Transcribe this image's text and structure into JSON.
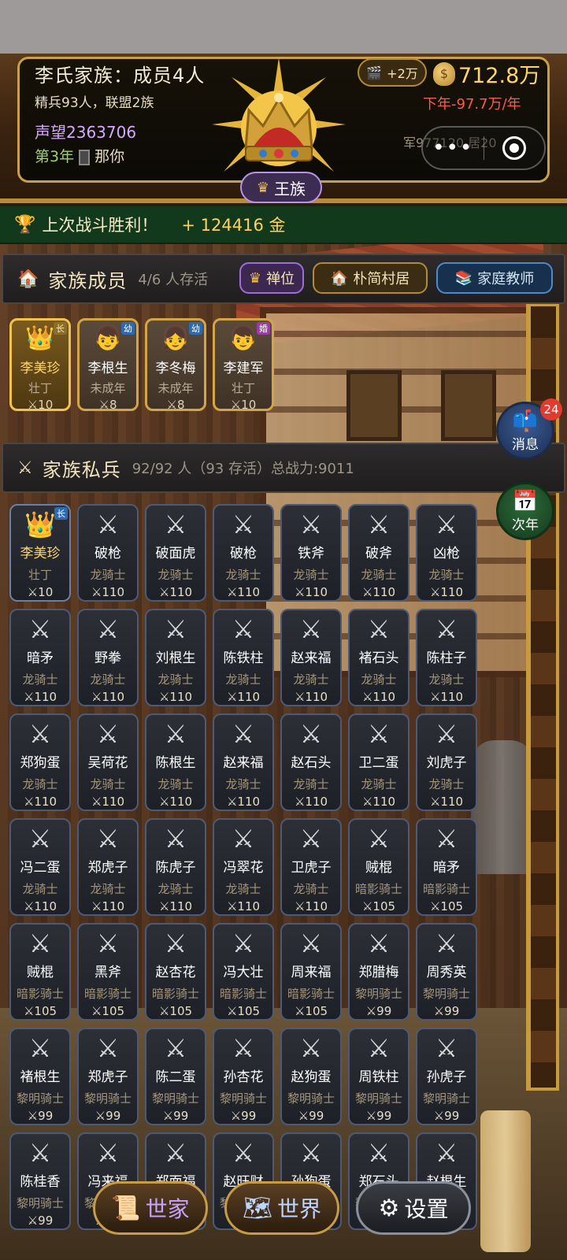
{
  "header": {
    "family_title": "李氏家族：成员4人",
    "family_sub": "精兵93人，联盟2族",
    "prestige": "声望2363706",
    "year": "第3年",
    "you_label": "那你",
    "rank": "王族",
    "video_bonus": "+2万",
    "gold": "712.8万",
    "income": "下年-97.7万/年",
    "army_stats": "军977120 居20",
    "capsule_more": "•••"
  },
  "battle": {
    "message": "上次战斗胜利！",
    "gain": "+ 124416 金"
  },
  "family": {
    "title": "家族成员",
    "meta": "4/6 人存活",
    "btn_abdicate": "禅位",
    "btn_house": "朴简村居",
    "btn_teacher": "家庭教师",
    "members": [
      {
        "name": "李美珍",
        "role": "壮丁",
        "power": "10",
        "tag": "长",
        "icon": "👑"
      },
      {
        "name": "李根生",
        "role": "未成年",
        "power": "8",
        "tag": "幼",
        "icon": "👦"
      },
      {
        "name": "李冬梅",
        "role": "未成年",
        "power": "8",
        "tag": "幼",
        "icon": "👧"
      },
      {
        "name": "李建军",
        "role": "壮丁",
        "power": "10",
        "tag": "婚",
        "icon": "👦"
      }
    ]
  },
  "army": {
    "title": "家族私兵",
    "meta": "92/92 人（93 存活）总战力:9011",
    "leader_tag": "长",
    "soldiers": [
      {
        "name": "李美珍",
        "role": "壮丁",
        "power": "10"
      },
      {
        "name": "破枪",
        "role": "龙骑士",
        "power": "110"
      },
      {
        "name": "破面虎",
        "role": "龙骑士",
        "power": "110"
      },
      {
        "name": "破枪",
        "role": "龙骑士",
        "power": "110"
      },
      {
        "name": "铁斧",
        "role": "龙骑士",
        "power": "110"
      },
      {
        "name": "破斧",
        "role": "龙骑士",
        "power": "110"
      },
      {
        "name": "凶枪",
        "role": "龙骑士",
        "power": "110"
      },
      {
        "name": "暗矛",
        "role": "龙骑士",
        "power": "110"
      },
      {
        "name": "野拳",
        "role": "龙骑士",
        "power": "110"
      },
      {
        "name": "刘根生",
        "role": "龙骑士",
        "power": "110"
      },
      {
        "name": "陈铁柱",
        "role": "龙骑士",
        "power": "110"
      },
      {
        "name": "赵来福",
        "role": "龙骑士",
        "power": "110"
      },
      {
        "name": "褚石头",
        "role": "龙骑士",
        "power": "110"
      },
      {
        "name": "陈柱子",
        "role": "龙骑士",
        "power": "110"
      },
      {
        "name": "郑狗蛋",
        "role": "龙骑士",
        "power": "110"
      },
      {
        "name": "吴荷花",
        "role": "龙骑士",
        "power": "110"
      },
      {
        "name": "陈根生",
        "role": "龙骑士",
        "power": "110"
      },
      {
        "name": "赵来福",
        "role": "龙骑士",
        "power": "110"
      },
      {
        "name": "赵石头",
        "role": "龙骑士",
        "power": "110"
      },
      {
        "name": "卫二蛋",
        "role": "龙骑士",
        "power": "110"
      },
      {
        "name": "刘虎子",
        "role": "龙骑士",
        "power": "110"
      },
      {
        "name": "冯二蛋",
        "role": "龙骑士",
        "power": "110"
      },
      {
        "name": "郑虎子",
        "role": "龙骑士",
        "power": "110"
      },
      {
        "name": "陈虎子",
        "role": "龙骑士",
        "power": "110"
      },
      {
        "name": "冯翠花",
        "role": "龙骑士",
        "power": "110"
      },
      {
        "name": "卫虎子",
        "role": "龙骑士",
        "power": "110"
      },
      {
        "name": "贼棍",
        "role": "暗影骑士",
        "power": "105"
      },
      {
        "name": "暗矛",
        "role": "暗影骑士",
        "power": "105"
      },
      {
        "name": "贼棍",
        "role": "暗影骑士",
        "power": "105"
      },
      {
        "name": "黑斧",
        "role": "暗影骑士",
        "power": "105"
      },
      {
        "name": "赵杏花",
        "role": "暗影骑士",
        "power": "105"
      },
      {
        "name": "冯大壮",
        "role": "暗影骑士",
        "power": "105"
      },
      {
        "name": "周来福",
        "role": "暗影骑士",
        "power": "105"
      },
      {
        "name": "郑腊梅",
        "role": "黎明骑士",
        "power": "99"
      },
      {
        "name": "周秀英",
        "role": "黎明骑士",
        "power": "99"
      },
      {
        "name": "褚根生",
        "role": "黎明骑士",
        "power": "99"
      },
      {
        "name": "郑虎子",
        "role": "黎明骑士",
        "power": "99"
      },
      {
        "name": "陈二蛋",
        "role": "黎明骑士",
        "power": "99"
      },
      {
        "name": "孙杏花",
        "role": "黎明骑士",
        "power": "99"
      },
      {
        "name": "赵狗蛋",
        "role": "黎明骑士",
        "power": "99"
      },
      {
        "name": "周铁柱",
        "role": "黎明骑士",
        "power": "99"
      },
      {
        "name": "孙虎子",
        "role": "黎明骑士",
        "power": "99"
      },
      {
        "name": "陈桂香",
        "role": "黎明骑士",
        "power": "99"
      },
      {
        "name": "冯来福",
        "role": "黎明骑士",
        "power": "99"
      },
      {
        "name": "郑面福",
        "role": "黎明骑士",
        "power": "99"
      },
      {
        "name": "赵旺财",
        "role": "黎明骑士",
        "power": "99"
      },
      {
        "name": "孙狗蛋",
        "role": "黎明骑士",
        "power": "99"
      },
      {
        "name": "郑石头",
        "role": "黎明骑士",
        "power": "99"
      },
      {
        "name": "赵根生",
        "role": "黎明骑士",
        "power": "99"
      }
    ]
  },
  "float": {
    "messages_label": "消息",
    "messages_count": "24",
    "next_year_label": "次年",
    "calendar_month": "JUL",
    "calendar_day": "17"
  },
  "nav": {
    "family_label": "世家",
    "world_label": "世界",
    "settings_label": "设置"
  }
}
